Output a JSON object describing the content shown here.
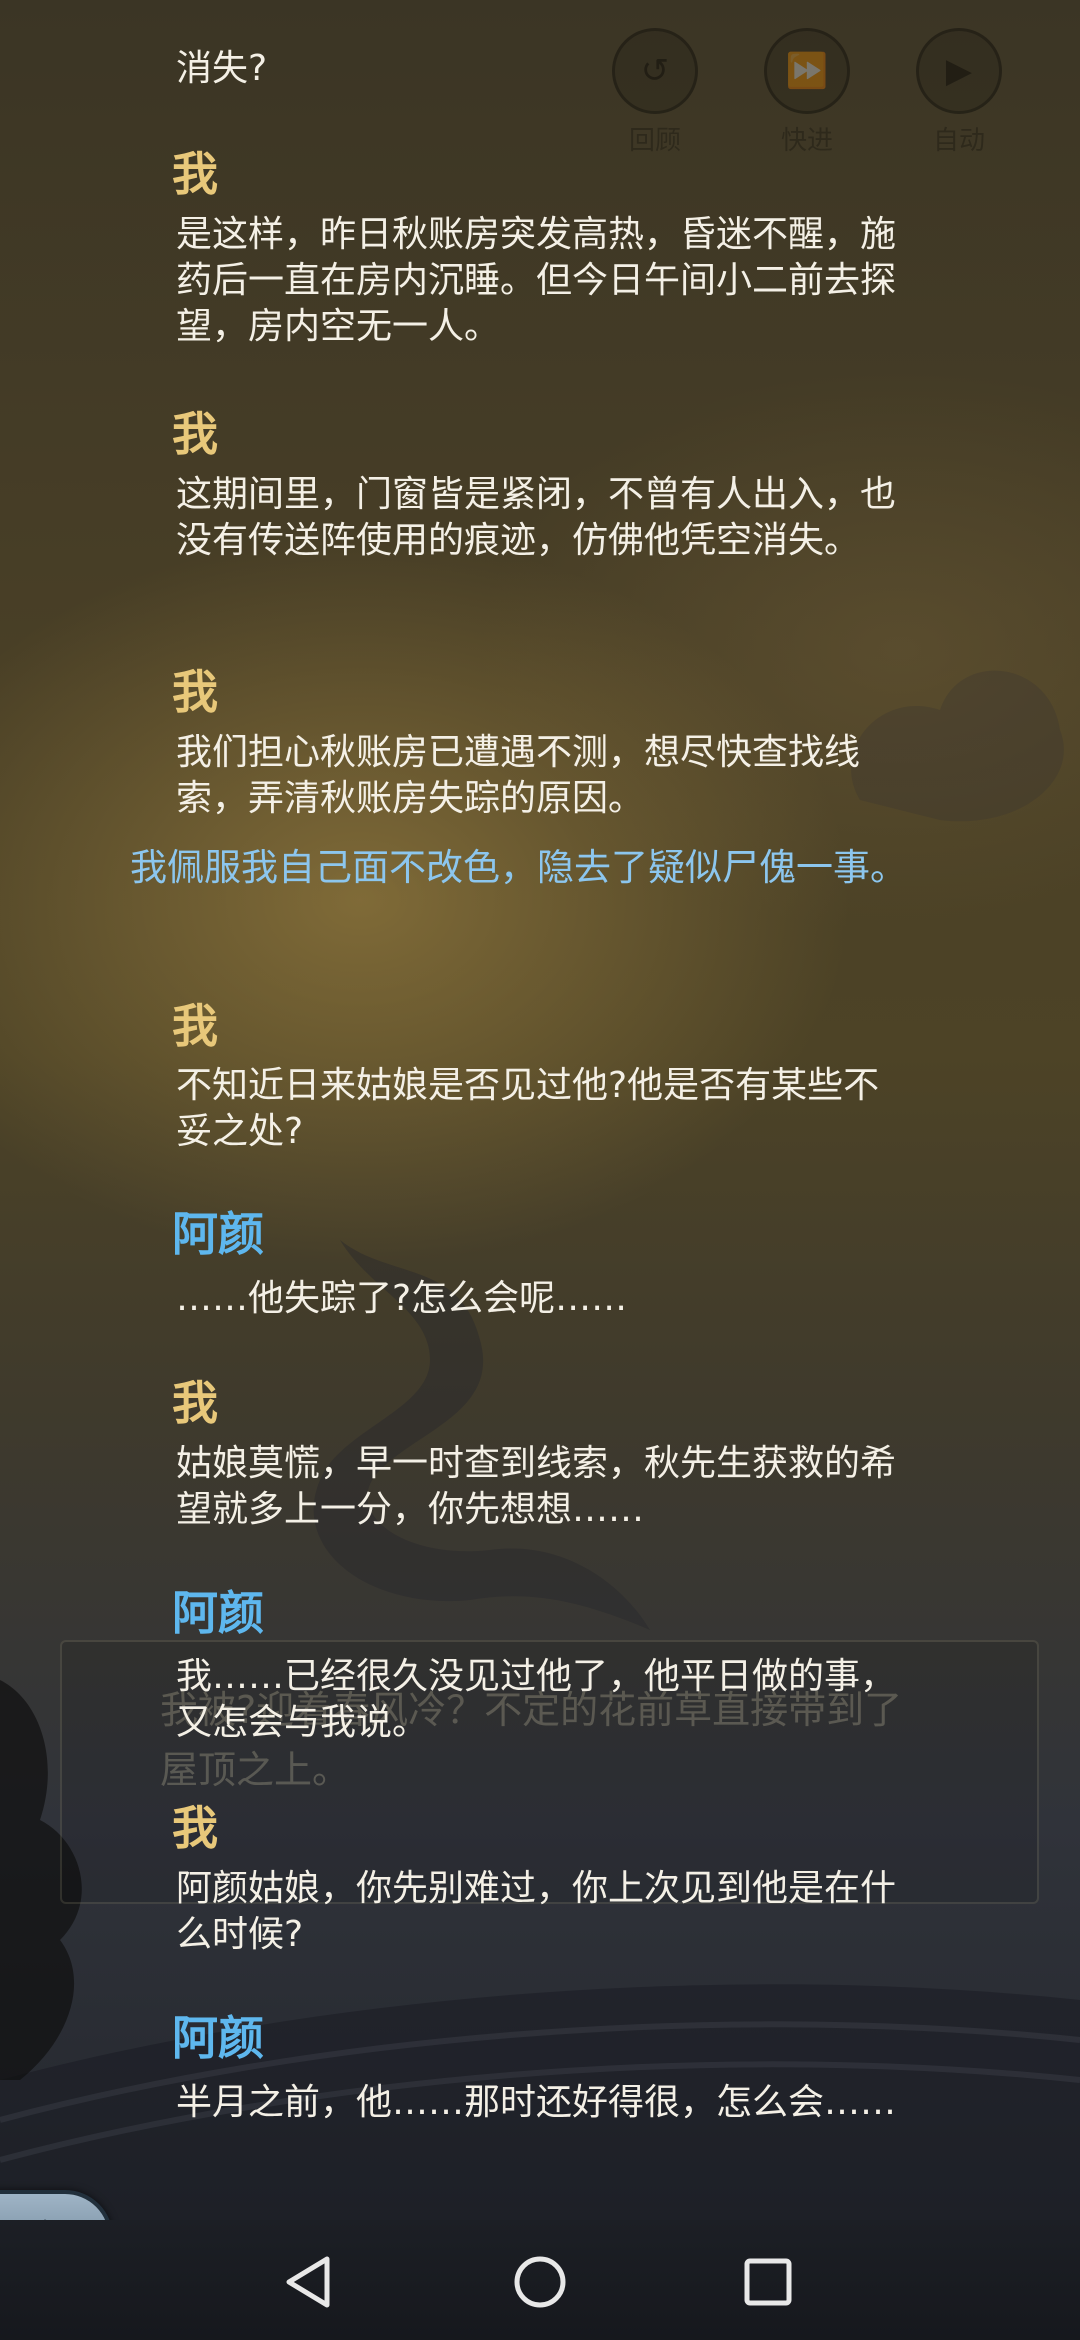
{
  "top_controls": {
    "review_label": "回顾",
    "fast_forward_label": "快进",
    "auto_label": "自动"
  },
  "background_dialog": {
    "text": "我被?迎着春风冷？不定的花前草直接带到了屋顶之上。"
  },
  "dialog": {
    "entries": [
      {
        "text": "消失?"
      },
      {
        "speaker": "我",
        "text": "是这样，昨日秋账房突发高热，昏迷不醒，施药后一直在房内沉睡。但今日午间小二前去探望，房内空无一人。"
      },
      {
        "speaker": "我",
        "text": "这期间里，门窗皆是紧闭，不曾有人出入，也没有传送阵使用的痕迹，仿佛他凭空消失。"
      },
      {
        "speaker": "我",
        "text": "我们担心秋账房已遭遇不测，想尽快查找线索，弄清秋账房失踪的原因。"
      },
      {
        "narration": "我佩服我自己面不改色，隐去了疑似尸傀一事。"
      },
      {
        "speaker": "我",
        "text": "不知近日来姑娘是否见过他?他是否有某些不妥之处?"
      },
      {
        "speaker": "阿颜",
        "text": "……他失踪了?怎么会呢……"
      },
      {
        "speaker": "我",
        "text": "姑娘莫慌，早一时查到线索，秋先生获救的希望就多上一分，你先想想……"
      },
      {
        "speaker": "阿颜",
        "text": "我……已经很久没见过他了，他平日做的事，又怎会与我说。"
      },
      {
        "speaker": "我",
        "text": "阿颜姑娘，你先别难过，你上次见到他是在什么时候?"
      },
      {
        "speaker": "阿颜",
        "text": "半月之前，他……那时还好得很，怎么会……"
      }
    ]
  },
  "colors": {
    "speaker_me": "#e8c87a",
    "speaker_ayan": "#5eb7ee",
    "narration": "#8cc6ee",
    "dialog_text": "#f4f0e6"
  },
  "icons": {
    "back": "undo-arrow-icon",
    "nav_back": "triangle-back-icon",
    "nav_home": "circle-home-icon",
    "nav_recents": "square-recents-icon"
  }
}
